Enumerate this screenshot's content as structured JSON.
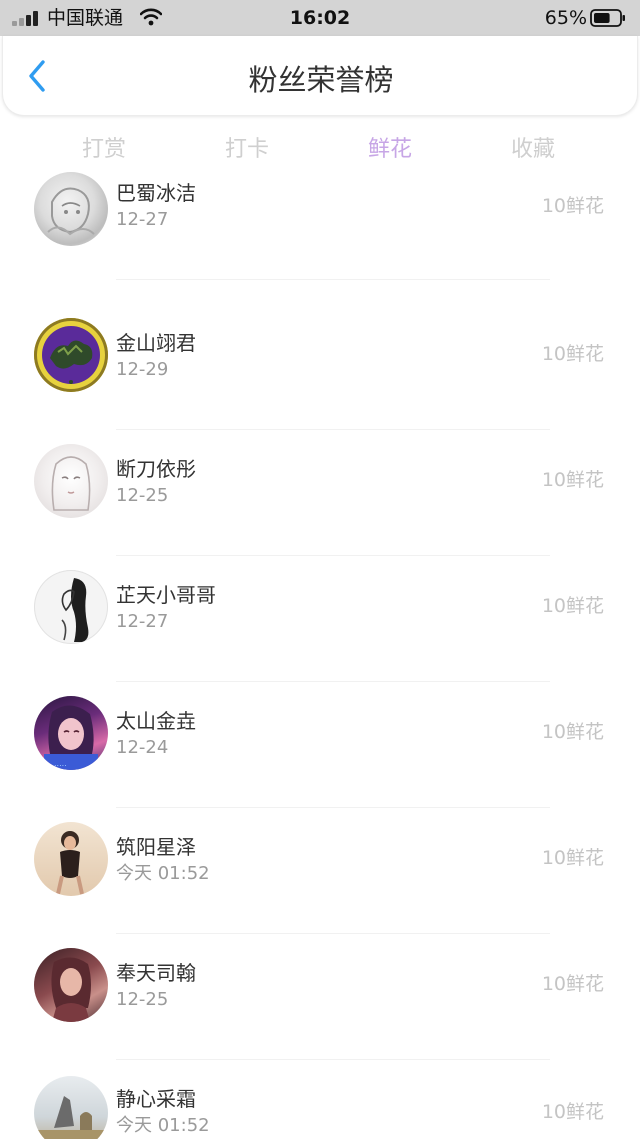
{
  "status_bar": {
    "carrier": "中国联通",
    "time": "16:02",
    "battery": "65%",
    "battery_level": 0.65
  },
  "header": {
    "title": "粉丝荣誉榜"
  },
  "tabs": [
    {
      "label": "打赏",
      "active": false
    },
    {
      "label": "打卡",
      "active": false
    },
    {
      "label": "鲜花",
      "active": true
    },
    {
      "label": "收藏",
      "active": false
    }
  ],
  "fans": [
    {
      "name": "巴蜀冰洁",
      "date": "12-27",
      "amount": "10鲜花",
      "avatar": "sketch"
    },
    {
      "name": "金山翊君",
      "date": "12-29",
      "amount": "10鲜花",
      "avatar": "dragon-emblem"
    },
    {
      "name": "断刀依彤",
      "date": "12-25",
      "amount": "10鲜花",
      "avatar": "anime-girl"
    },
    {
      "name": "芷天小哥哥",
      "date": "12-27",
      "amount": "10鲜花",
      "avatar": "ink-figure"
    },
    {
      "name": "太山金垚",
      "date": "12-24",
      "amount": "10鲜花",
      "avatar": "portrait-pink"
    },
    {
      "name": "筑阳星泽",
      "date": "今天 01:52",
      "amount": "10鲜花",
      "avatar": "portrait-beige"
    },
    {
      "name": "奉天司翰",
      "date": "12-25",
      "amount": "10鲜花",
      "avatar": "portrait-dark"
    },
    {
      "name": "静心采霜",
      "date": "今天 01:52",
      "amount": "10鲜花",
      "avatar": "landscape"
    }
  ],
  "colors": {
    "accent": "#c7a6e6",
    "back_arrow": "#2f9cf0",
    "tab_inactive": "#cfcfcf",
    "status_bar_bg": "#d4d4d4"
  }
}
